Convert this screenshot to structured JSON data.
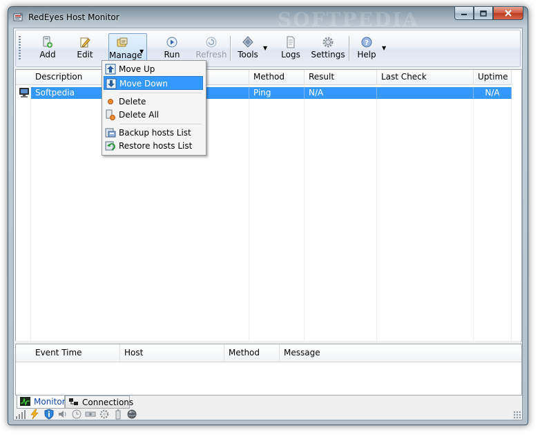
{
  "window": {
    "title": "RedEyes Host Monitor",
    "watermark": "SOFTPEDIA"
  },
  "toolbar": {
    "add": "Add",
    "edit": "Edit",
    "manage": "Manage",
    "run": "Run",
    "refresh": "Refresh",
    "tools": "Tools",
    "logs": "Logs",
    "settings": "Settings",
    "help": "Help"
  },
  "manage_menu": {
    "move_up": "Move Up",
    "move_down": "Move Down",
    "delete": "Delete",
    "delete_all": "Delete All",
    "backup": "Backup hosts List",
    "restore": "Restore hosts List"
  },
  "hosts": {
    "columns": [
      "Description",
      "Method",
      "Result",
      "Last Check",
      "Uptime"
    ],
    "rows": [
      {
        "description": "Softpedia",
        "method": "Ping",
        "result": "N/A",
        "last_check": "",
        "uptime": "N/A"
      }
    ]
  },
  "events": {
    "columns": [
      "Event Time",
      "Host",
      "Method",
      "Message"
    ]
  },
  "tabs": {
    "monitor": "Monitor",
    "connections": "Connections"
  },
  "colors": {
    "selection": "#3399ff",
    "active_tab_text": "#0b46a8"
  }
}
